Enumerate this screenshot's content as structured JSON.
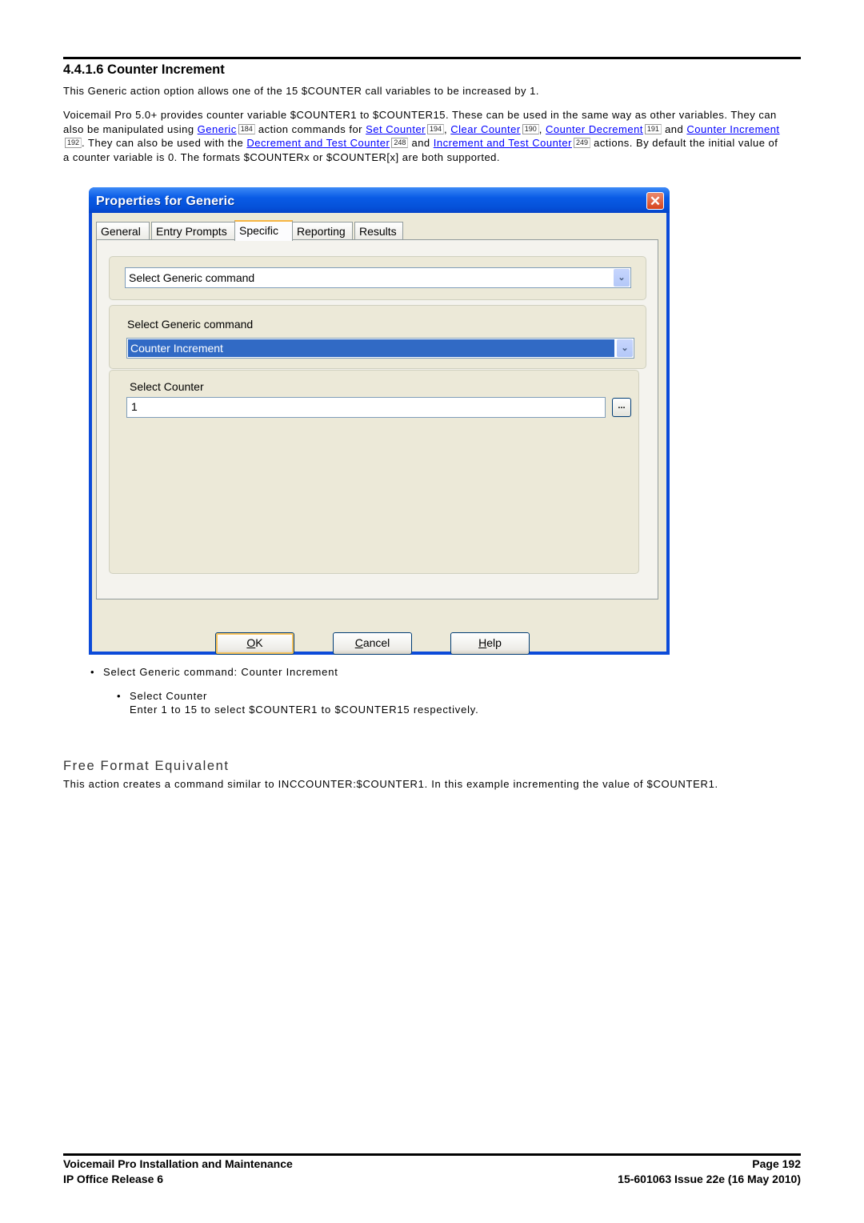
{
  "section": {
    "number": "4.4.1.6",
    "title": "4.4.1.6 Counter Increment"
  },
  "intro": "This Generic action option allows one of the 15 $COUNTER call variables to be increased by 1.",
  "description": {
    "t1": "Voicemail Pro 5.0+ provides counter variable $COUNTER1 to $COUNTER15. These can be used in the same way as other variables. They can also be manipulated using ",
    "link_generic": "Generic",
    "ref_generic": "184",
    "t2": " action commands for ",
    "link_set_counter": "Set Counter",
    "ref_set_counter": "194",
    "t3": ", ",
    "link_clear_counter": "Clear Counter",
    "ref_clear_counter": "190",
    "t4": ", ",
    "link_counter_decrement": "Counter Decrement",
    "ref_counter_decrement": "191",
    "t5": " and ",
    "link_counter_increment": "Counter Increment",
    "ref_counter_increment": "192",
    "t6": ". They can also be used with the ",
    "link_decrement_test": "Decrement and Test Counter",
    "ref_decrement_test": "248",
    "t7": " and ",
    "link_increment_test": "Increment and Test Counter",
    "ref_increment_test": "249",
    "t8": " actions. By default the initial value of a counter variable is 0.  The formats $COUNTERx or $COUNTER[x] are both supported."
  },
  "dialog": {
    "title": "Properties for Generic",
    "close_glyph": "✕",
    "tabs": [
      {
        "label": "General",
        "active": false
      },
      {
        "label": "Entry Prompts",
        "active": false
      },
      {
        "label": "Specific",
        "active": true
      },
      {
        "label": "Reporting",
        "active": false
      },
      {
        "label": "Results",
        "active": false
      }
    ],
    "command_combo": {
      "value": "Select Generic command"
    },
    "group_label": "Select Generic command",
    "generic_command_combo": {
      "value": "Counter Increment"
    },
    "counter_label": "Select Counter",
    "counter_value": "1",
    "browse_label": "...",
    "dropdown_glyph": "⌄",
    "buttons": {
      "ok": {
        "accel": "O",
        "rest": "K"
      },
      "cancel": {
        "accel": "C",
        "rest": "ancel"
      },
      "help": {
        "accel": "H",
        "rest": "elp"
      }
    }
  },
  "bullets": [
    {
      "text": "Select Generic command: Counter Increment"
    },
    {
      "text": "Select Counter",
      "detail": "Enter 1 to 15 to select $COUNTER1 to $COUNTER15 respectively."
    }
  ],
  "bullet_glyph": "•",
  "free_format": {
    "heading": "Free Format Equivalent",
    "text": "This action creates a command similar to INCCOUNTER:$COUNTER1. In this example incrementing the value of $COUNTER1."
  },
  "footer": {
    "doc_title": "Voicemail Pro Installation and Maintenance",
    "release": "IP Office Release 6",
    "page": "Page 192",
    "issue": "15-601063 Issue 22e (16 May 2010)"
  }
}
